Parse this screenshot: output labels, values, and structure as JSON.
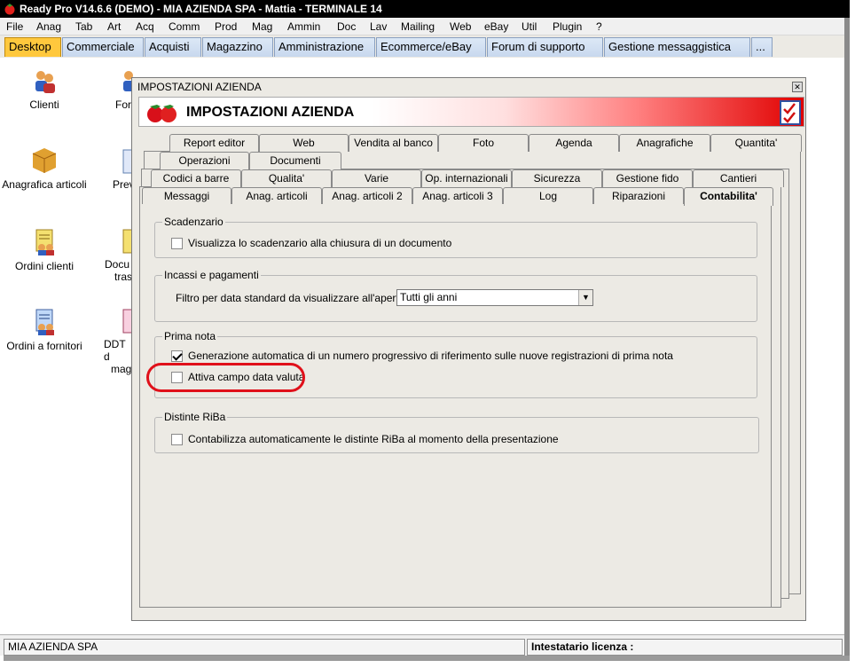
{
  "window": {
    "title": "Ready Pro V14.6.6 (DEMO) - MIA AZIENDA SPA - Mattia - TERMINALE 14"
  },
  "menu": [
    "File",
    "Anag",
    "Tab",
    "Art",
    "Acq",
    "Comm",
    "Prod",
    "Mag",
    "Ammin",
    "Doc",
    "Lav",
    "Mailing",
    "Web",
    "eBay",
    "Util",
    "Plugin",
    "?"
  ],
  "main_tabs": [
    "Desktop",
    "Commerciale",
    "Acquisti",
    "Magazzino",
    "Amministrazione",
    "Ecommerce/eBay",
    "Forum di supporto",
    "Gestione messaggistica",
    "..."
  ],
  "desktop_icons": {
    "col1": [
      "Clienti",
      "Anagrafica articoli",
      "Ordini clienti",
      "Ordini a fornitori"
    ],
    "col2": [
      "Forn",
      "Prev",
      "Docu",
      "trasp",
      "DDT d",
      "maga"
    ]
  },
  "status": {
    "company": "MIA AZIENDA SPA",
    "license_label": "Intestatario licenza :"
  },
  "dialog": {
    "title": "IMPOSTAZIONI AZIENDA",
    "header": "IMPOSTAZIONI AZIENDA",
    "tabs_row1": [
      "Report editor",
      "Web",
      "Vendita al banco",
      "Foto",
      "Agenda",
      "Anagrafiche",
      "Quantita'"
    ],
    "tabs_row2": [
      "Operazioni",
      "Documenti"
    ],
    "tabs_row3": [
      "Codici a barre",
      "Qualita'",
      "Varie",
      "Op. internazionali",
      "Sicurezza",
      "Gestione fido",
      "Cantieri"
    ],
    "tabs_row4": [
      "Messaggi",
      "Anag. articoli",
      "Anag. articoli 2",
      "Anag. articoli 3",
      "Log",
      "Riparazioni",
      "Contabilita'"
    ],
    "groups": {
      "scadenzario": {
        "legend": "Scadenzario",
        "option": "Visualizza lo scadenzario alla chiusura di un documento",
        "checked": false
      },
      "incassi": {
        "legend": "Incassi e pagamenti",
        "label": "Filtro per data standard da visualizzare all'apertura :",
        "select_value": "Tutti gli anni"
      },
      "prima_nota": {
        "legend": "Prima nota",
        "option1": "Generazione automatica di un numero progressivo di riferimento sulle nuove registrazioni di prima nota",
        "option1_checked": true,
        "option2": "Attiva campo data valuta",
        "option2_checked": false
      },
      "riba": {
        "legend": "Distinte RiBa",
        "option": "Contabilizza automaticamente le distinte RiBa al momento della presentazione",
        "checked": false
      }
    }
  },
  "colors": {
    "highlight": "#e0101a",
    "active_tab": "#ffc83d"
  }
}
